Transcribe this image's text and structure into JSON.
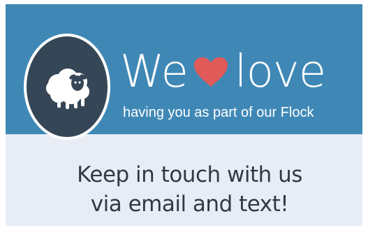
{
  "banner": {
    "headline_prefix": "We",
    "headline_suffix": "love",
    "subline": "having you as part of our Flock",
    "heart_icon": "heart-icon",
    "logo_icon": "sheep-icon"
  },
  "message": {
    "line1": "Keep in touch with us",
    "line2": "via email and text!"
  },
  "colors": {
    "banner_background": "#3f88b6",
    "lower_background": "#e8edf5",
    "logo_circle": "#354657",
    "heart": "#e05a59",
    "text_light": "#ffffff",
    "text_dark": "#2e3a46"
  }
}
